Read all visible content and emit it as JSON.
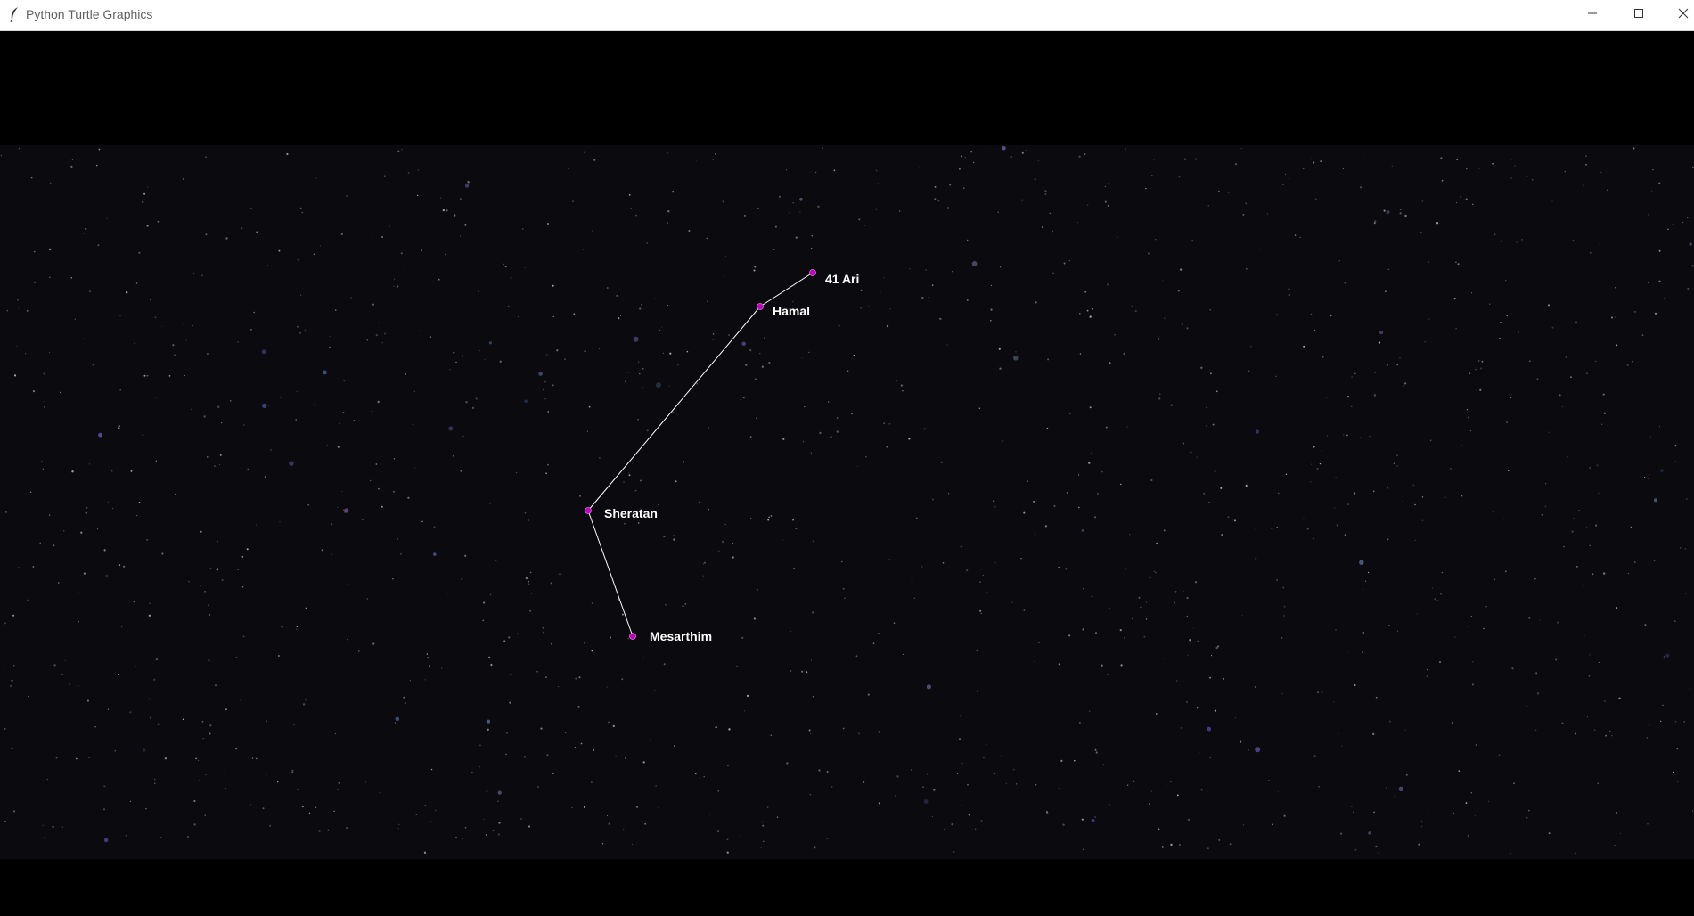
{
  "window": {
    "title": "Python Turtle Graphics",
    "icon": "feather-icon",
    "controls": [
      "minimize-icon",
      "maximize-icon",
      "close-icon"
    ]
  },
  "colors": {
    "background": "#000000",
    "sky": "#0b0a0e",
    "line": "#ffffff",
    "star_marker": "#c000c0",
    "label": "#ffffff"
  },
  "constellation": {
    "stars": [
      {
        "name": "41 Ari"
      },
      {
        "name": "Hamal"
      },
      {
        "name": "Sheratan"
      },
      {
        "name": "Mesarthim"
      }
    ],
    "connections": [
      [
        "41 Ari",
        "Hamal"
      ],
      [
        "Hamal",
        "Sheratan"
      ],
      [
        "Sheratan",
        "Mesarthim"
      ]
    ]
  }
}
